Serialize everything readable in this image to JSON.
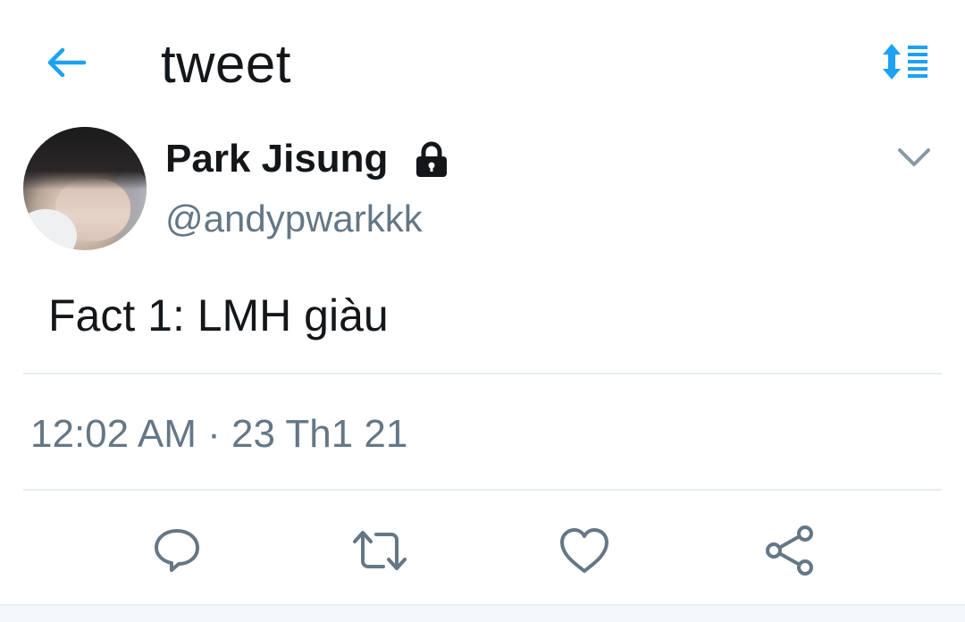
{
  "header": {
    "title": "tweet",
    "back_icon": "arrow-left-icon",
    "sort_icon": "sort-list-icon",
    "accent_color": "#1da1f2"
  },
  "tweet": {
    "author": {
      "display_name": "Park Jisung",
      "handle": "@andypwarkkk",
      "protected": true,
      "lock_icon": "lock-icon"
    },
    "text": "Fact 1: LMH giàu",
    "timestamp": "12:02 AM · 23 Th1 21",
    "more_icon": "chevron-down-icon"
  },
  "actions": [
    {
      "name": "reply",
      "icon": "reply-icon"
    },
    {
      "name": "retweet",
      "icon": "retweet-icon"
    },
    {
      "name": "like",
      "icon": "heart-icon"
    },
    {
      "name": "share",
      "icon": "share-icon"
    }
  ],
  "colors": {
    "text_primary": "#14171a",
    "text_secondary": "#657786",
    "divider": "#e6ecf0",
    "icon_gray": "#657786"
  }
}
